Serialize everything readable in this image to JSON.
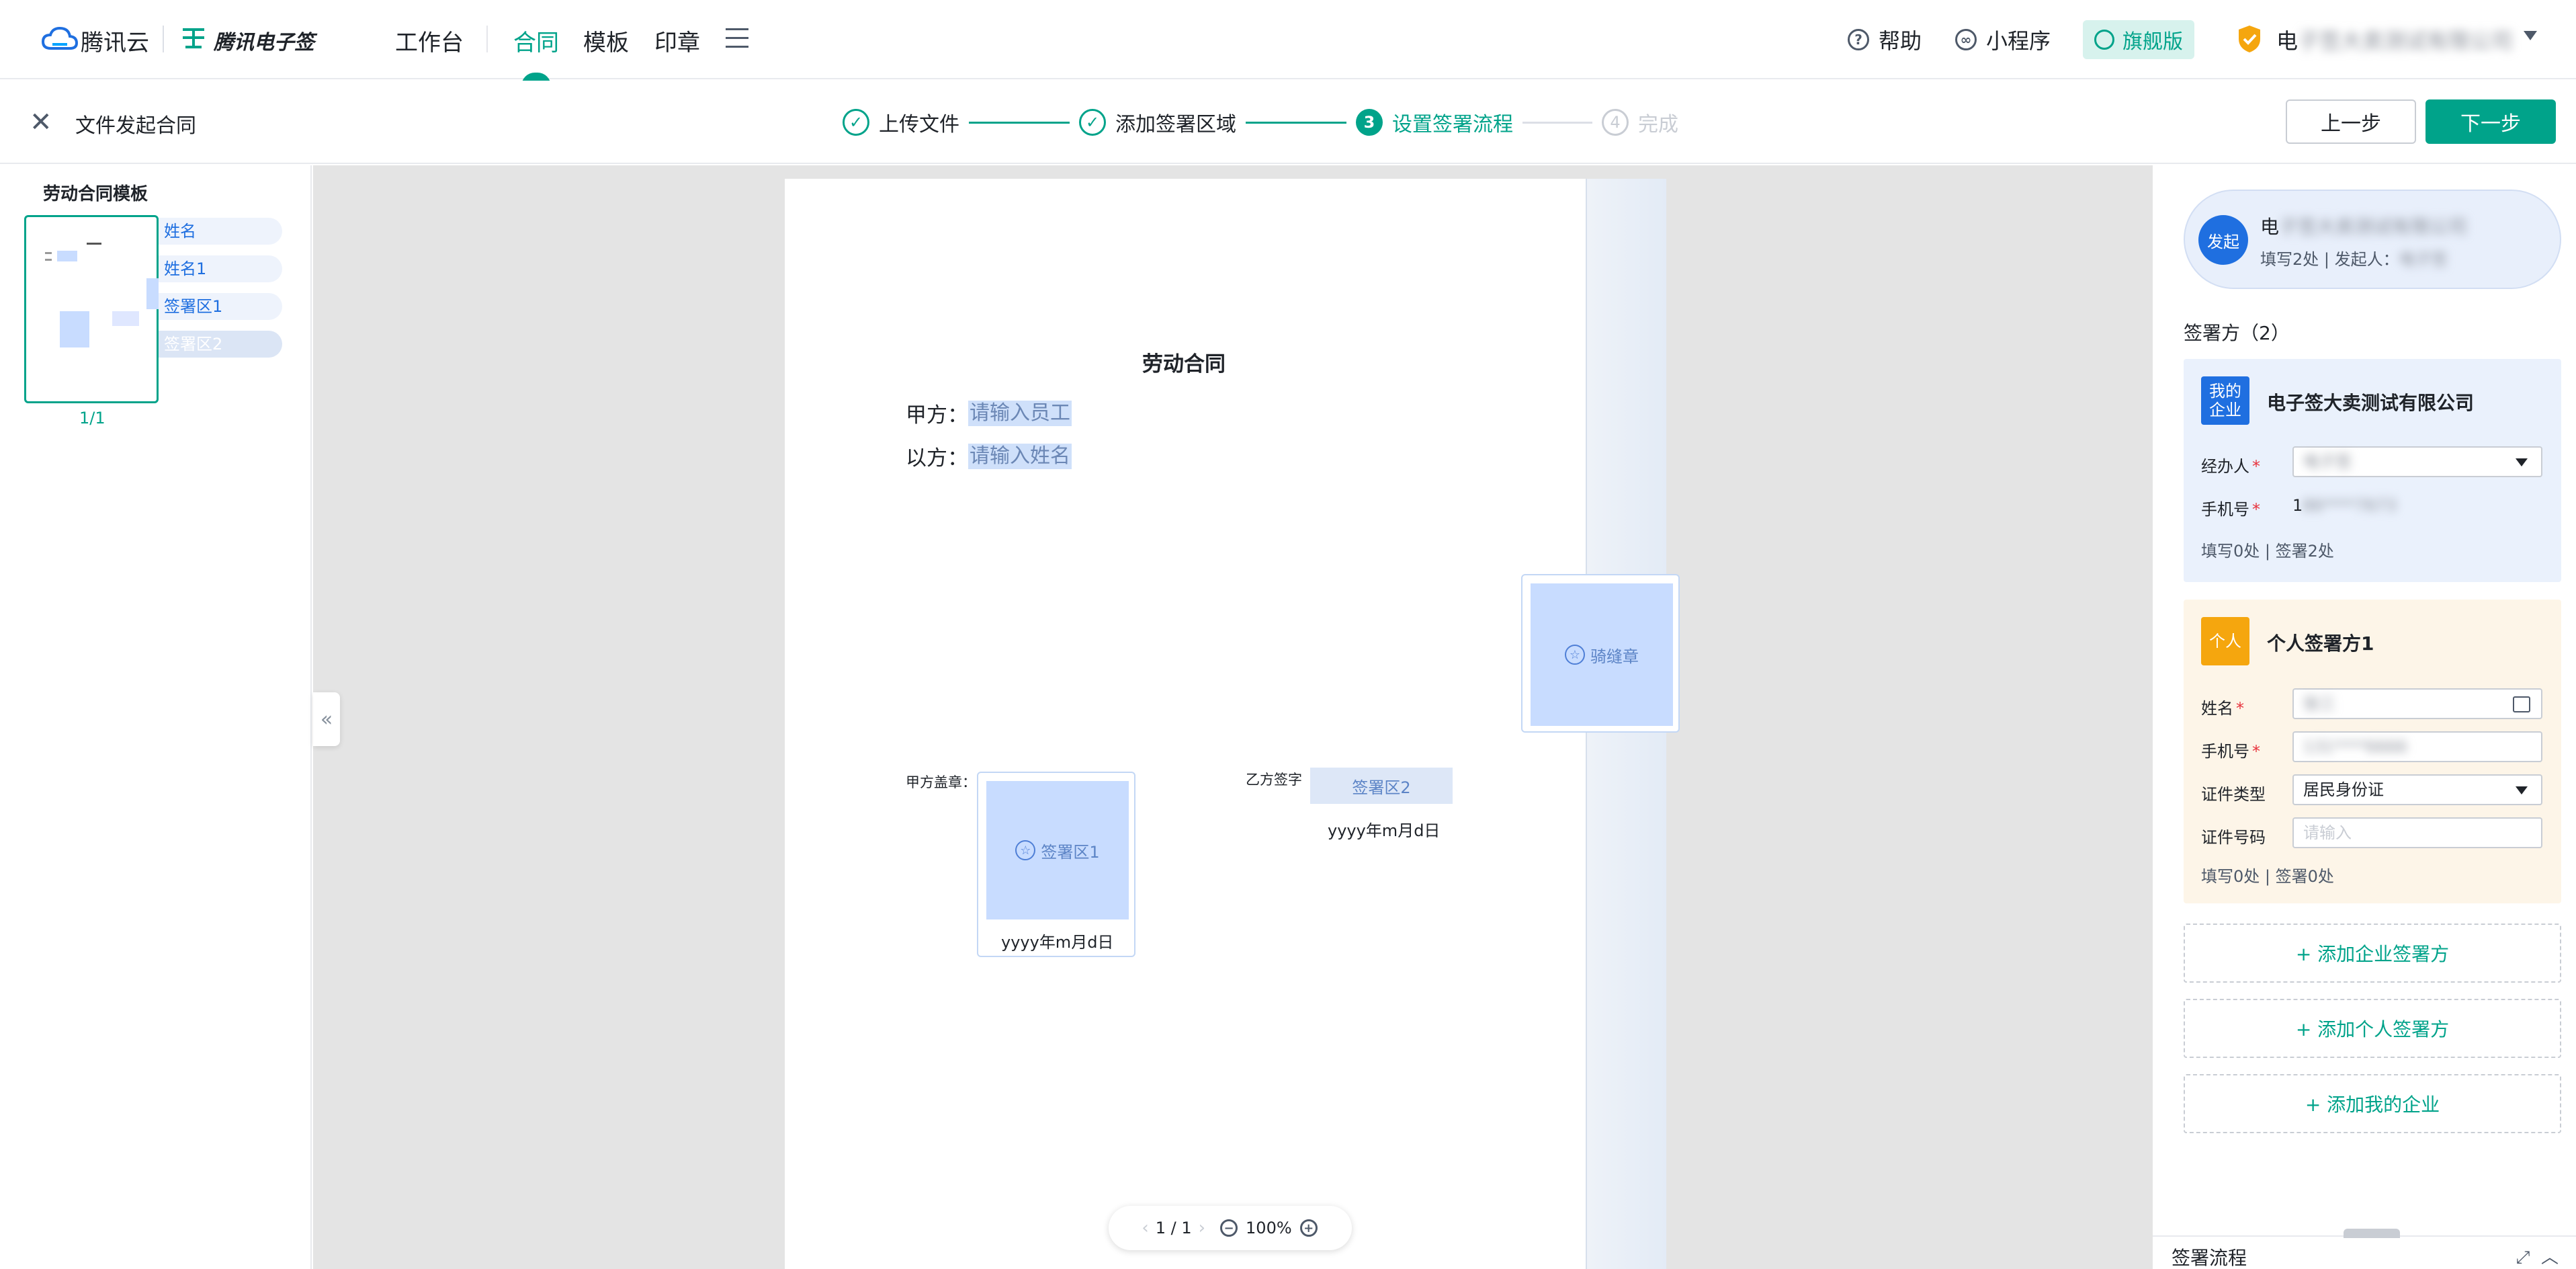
{
  "topnav": {
    "brand": "腾讯云",
    "product": "腾讯电子签",
    "items": [
      "工作台",
      "合同",
      "模板",
      "印章"
    ],
    "active_index": 1,
    "help": "帮助",
    "miniprogram": "小程序",
    "edition": "旗舰版",
    "company_prefix": "电",
    "company_blurred": "子签大卖测试有限公司"
  },
  "subheader": {
    "title": "文件发起合同",
    "steps": [
      {
        "num": "✓",
        "label": "上传文件",
        "state": "done"
      },
      {
        "num": "✓",
        "label": "添加签署区域",
        "state": "done"
      },
      {
        "num": "3",
        "label": "设置签署流程",
        "state": "current"
      },
      {
        "num": "4",
        "label": "完成",
        "state": "todo"
      }
    ],
    "prev_label": "上一步",
    "next_label": "下一步"
  },
  "left": {
    "template_name": "劳动合同模板",
    "fields": [
      "姓名",
      "姓名1",
      "签署区1",
      "签署区2"
    ],
    "page_indicator": "1/1"
  },
  "document": {
    "title": "劳动合同",
    "party_a_label": "甲方：",
    "party_a_field": "请输入员工",
    "party_b_label": "以方：",
    "party_b_field": "请输入姓名",
    "seam_seal": "骑缝章",
    "party_a_stamp_label": "甲方盖章：",
    "sign_area_1": "签署区1",
    "date_1": "yyyy年m月d日",
    "party_b_sign_label": "乙方签字",
    "sign_area_2": "签署区2",
    "date_2": "yyyy年m月d日",
    "pager": "1 / 1",
    "zoom": "100%"
  },
  "right": {
    "initiator_badge": "发起",
    "initiator_name_prefix": "电",
    "initiator_name_blurred": "子签大卖测试有限公司",
    "initiator_meta": "填写2处 | 发起人：",
    "initiator_person_blurred": "电子签",
    "signers_title": "签署方（2）",
    "enterprise": {
      "badge_line1": "我的",
      "badge_line2": "企业",
      "name": "电子签大卖测试有限公司",
      "operator_label": "经办人",
      "operator_value": "电子签",
      "phone_label": "手机号",
      "phone_prefix": "1",
      "phone_blurred": "86****7673",
      "summary": "填写0处 | 签署2处"
    },
    "personal": {
      "badge": "个人",
      "name": "个人签署方1",
      "name_label": "姓名",
      "name_value": "张三",
      "phone_label": "手机号",
      "phone_value": "131****6666",
      "id_type_label": "证件类型",
      "id_type_value": "居民身份证",
      "id_no_label": "证件号码",
      "id_no_placeholder": "请输入",
      "summary": "填写0处 | 签署0处"
    },
    "add_enterprise": "+ 添加企业签署方",
    "add_personal": "+ 添加个人签署方",
    "add_my_company": "+ 添加我的企业",
    "flow_title": "签署流程"
  },
  "colors": {
    "accent": "#00a38a",
    "blue": "#1f6fe0",
    "orange": "#f5a60e"
  }
}
